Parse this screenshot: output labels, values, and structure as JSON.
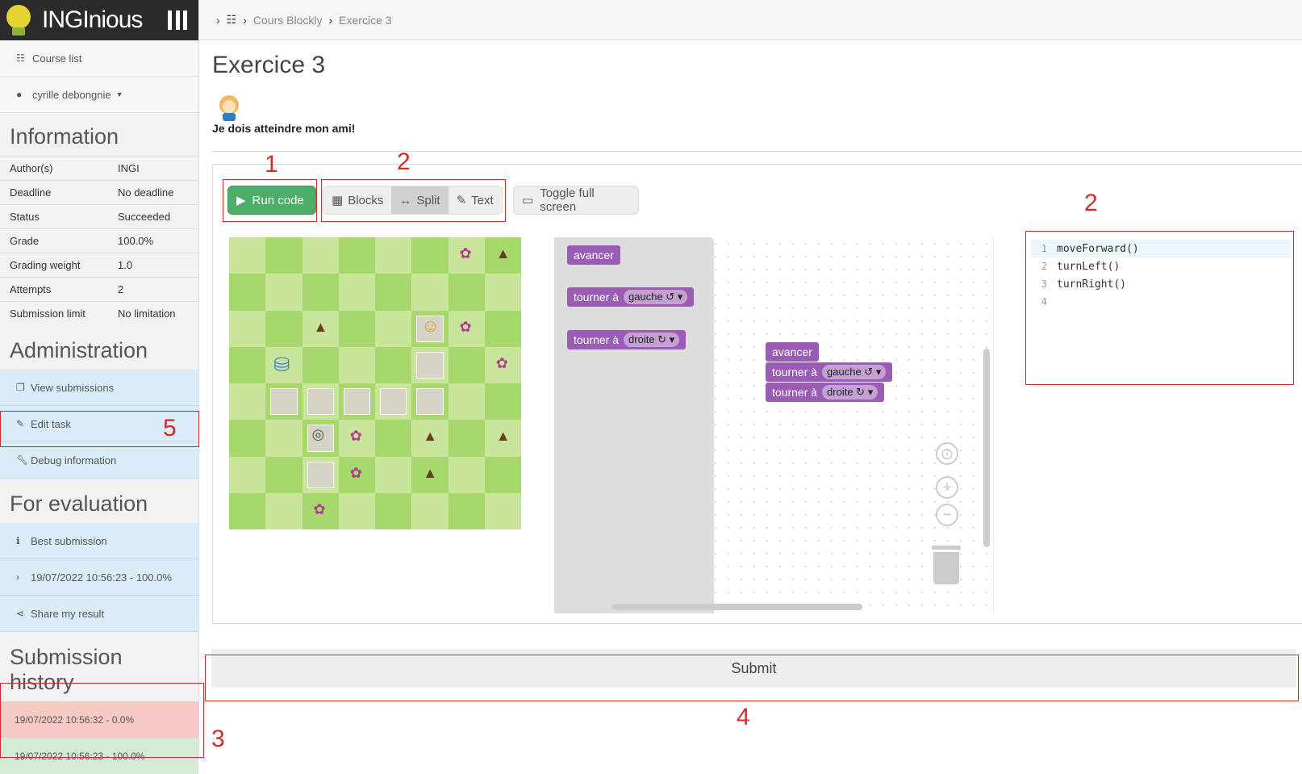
{
  "app": {
    "name": "INGInious"
  },
  "breadcrumb": {
    "course": "Cours Blockly",
    "task": "Exercice 3"
  },
  "sidebar": {
    "course_list": "Course list",
    "user": "cyrille debongnie",
    "information_title": "Information",
    "info": [
      {
        "key": "Author(s)",
        "value": "INGI"
      },
      {
        "key": "Deadline",
        "value": "No deadline"
      },
      {
        "key": "Status",
        "value": "Succeeded"
      },
      {
        "key": "Grade",
        "value": "100.0%"
      },
      {
        "key": "Grading weight",
        "value": "1.0"
      },
      {
        "key": "Attempts",
        "value": "2"
      },
      {
        "key": "Submission limit",
        "value": "No limitation"
      }
    ],
    "administration_title": "Administration",
    "admin_links": [
      "View submissions",
      "Edit task",
      "Debug information"
    ],
    "evaluation_title": "For evaluation",
    "evaluation_links": [
      "Best submission",
      "19/07/2022 10:56:23 - 100.0%",
      "Share my result"
    ],
    "history_title": "Submission history",
    "history": [
      {
        "label": "19/07/2022 10:56:32 - 0.0%",
        "status": "failed"
      },
      {
        "label": "19/07/2022 10:56:23 - 100.0%",
        "status": "success"
      }
    ]
  },
  "task": {
    "title": "Exercice 3",
    "description": "Je dois atteindre mon ami!"
  },
  "toolbar": {
    "run": "Run code",
    "modes": [
      "Blocks",
      "Split",
      "Text"
    ],
    "active_mode": "Split",
    "fullscreen": "Toggle full screen"
  },
  "blockly": {
    "toolbox": [
      {
        "label": "avancer"
      },
      {
        "label": "tourner à",
        "option": "gauche ↺"
      },
      {
        "label": "tourner à",
        "option": "droite ↻"
      }
    ],
    "workspace": [
      {
        "label": "avancer"
      },
      {
        "label": "tourner à",
        "option": "gauche ↺"
      },
      {
        "label": "tourner à",
        "option": "droite ↻"
      }
    ]
  },
  "code": {
    "lines": [
      "moveForward()",
      "turnLeft()",
      "turnRight()",
      ""
    ]
  },
  "submit": {
    "label": "Submit"
  },
  "annotations": [
    "1",
    "2",
    "2",
    "3",
    "4",
    "5"
  ],
  "colors": {
    "run": "#4cae68",
    "block": "#9a5cb4",
    "annotation": "#d32b2b"
  }
}
